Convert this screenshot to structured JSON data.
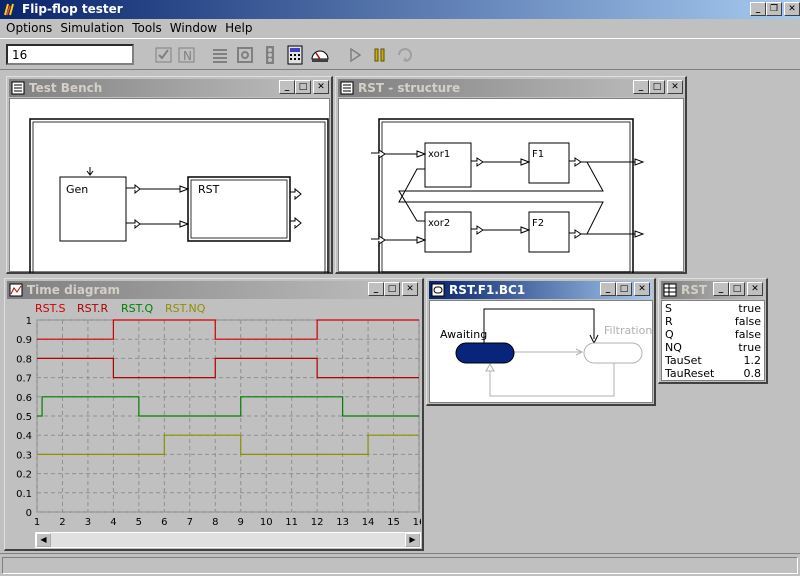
{
  "app": {
    "title": "Flip-flop tester",
    "colors": {
      "titlebar": "#08246b",
      "signal_s": "#d00000",
      "signal_r": "#b00000",
      "signal_q": "#008000",
      "signal_nq": "#909000",
      "state_active": "#08247b"
    }
  },
  "menu": [
    "Options",
    "Simulation",
    "Tools",
    "Window",
    "Help"
  ],
  "toolbar": {
    "step_value": "16",
    "icons": [
      "check-icon",
      "n-icon",
      "list-icon",
      "gear-icon",
      "traffic-light-icon",
      "calculator-icon",
      "gauge-icon",
      "play-icon",
      "pause-icon",
      "step-icon"
    ]
  },
  "test_bench": {
    "title": "Test Bench",
    "blocks": {
      "gen": "Gen",
      "rst": "RST"
    }
  },
  "rst_structure": {
    "title": "RST - structure",
    "blocks": {
      "xor1": "xor1",
      "xor2": "xor2",
      "f1": "F1",
      "f2": "F2"
    }
  },
  "time_diagram": {
    "title": "Time diagram",
    "legend": [
      "RST.S",
      "RST.R",
      "RST.Q",
      "RST.NQ"
    ]
  },
  "chart_data": {
    "type": "line",
    "x": [
      1,
      2,
      3,
      4,
      5,
      6,
      7,
      8,
      9,
      10,
      11,
      12,
      13,
      14,
      15,
      16
    ],
    "xticks": [
      "1",
      "2",
      "3",
      "4",
      "5",
      "6",
      "7",
      "8",
      "9",
      "10",
      "11",
      "12",
      "13",
      "14",
      "15",
      "16"
    ],
    "yticks": [
      "1",
      "0.9",
      "0.8",
      "0.7",
      "0.6",
      "0.5",
      "0.4",
      "0.3",
      "0.2",
      "0.1",
      "0"
    ],
    "ylim": [
      0,
      1
    ],
    "xlim": [
      1,
      16
    ],
    "series": [
      {
        "name": "RST.S",
        "color": "#d00000",
        "steps": [
          [
            1,
            0.9
          ],
          [
            4,
            1.0
          ],
          [
            8,
            0.9
          ],
          [
            12,
            1.0
          ],
          [
            16,
            1.0
          ]
        ]
      },
      {
        "name": "RST.R",
        "color": "#b00000",
        "steps": [
          [
            1,
            0.8
          ],
          [
            4,
            0.7
          ],
          [
            8,
            0.8
          ],
          [
            12,
            0.7
          ],
          [
            16,
            0.7
          ]
        ]
      },
      {
        "name": "RST.Q",
        "color": "#008000",
        "steps": [
          [
            1,
            0.5
          ],
          [
            1.2,
            0.6
          ],
          [
            5,
            0.5
          ],
          [
            9,
            0.6
          ],
          [
            13,
            0.5
          ],
          [
            16,
            0.5
          ]
        ]
      },
      {
        "name": "RST.NQ",
        "color": "#909000",
        "steps": [
          [
            1,
            0.3
          ],
          [
            6,
            0.4
          ],
          [
            9,
            0.3
          ],
          [
            14,
            0.4
          ],
          [
            16,
            0.4
          ]
        ]
      }
    ],
    "grid": true
  },
  "state_chart": {
    "title": "RST.F1.BC1",
    "states": [
      "Awaiting",
      "Filtration"
    ]
  },
  "rst_panel": {
    "title": "RST",
    "rows": [
      {
        "name": "S",
        "value": "true"
      },
      {
        "name": "R",
        "value": "false"
      },
      {
        "name": "Q",
        "value": "false"
      },
      {
        "name": "NQ",
        "value": "true"
      },
      {
        "name": "TauSet",
        "value": "1.2"
      },
      {
        "name": "TauReset",
        "value": "0.8"
      }
    ]
  }
}
